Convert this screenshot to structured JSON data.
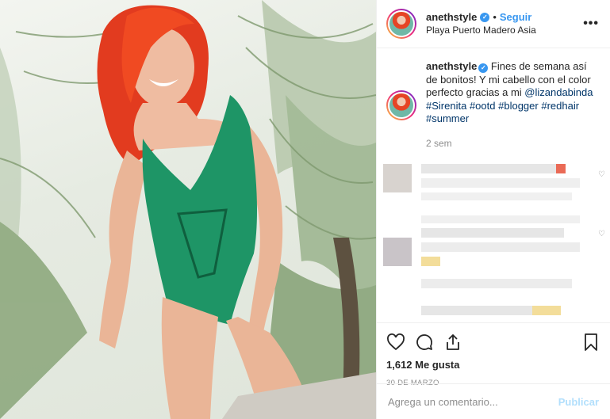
{
  "post": {
    "image_alt": "Mujer pelirroja con traje de baño verde entre palmeras"
  },
  "header": {
    "username": "anethstyle",
    "verified_icon": "verified-badge-icon",
    "separator": "•",
    "follow_label": "Seguir",
    "location": "Playa Puerto Madero Asia",
    "more_label": "•••"
  },
  "caption": {
    "username": "anethstyle",
    "text_before": " Fines de semana así de bonitos! Y mi cabello con el color perfecto gracias a mi ",
    "mention": "@lizandabinda",
    "hashtags": [
      "#Sirenita",
      "#ootd",
      "#blogger",
      "#redhair",
      "#summer"
    ],
    "time": "2 sem"
  },
  "actions": {
    "icons": [
      "heart-icon",
      "comment-icon",
      "share-icon",
      "bookmark-icon"
    ],
    "likes": "1,612 Me gusta",
    "date": "30 DE MARZO"
  },
  "comment_box": {
    "placeholder": "Agrega un comentario...",
    "publish_label": "Publicar"
  },
  "colors": {
    "link": "#3897f0",
    "hashtag": "#003569",
    "muted": "#8e8e8e",
    "publish_disabled": "#b2dffc"
  }
}
